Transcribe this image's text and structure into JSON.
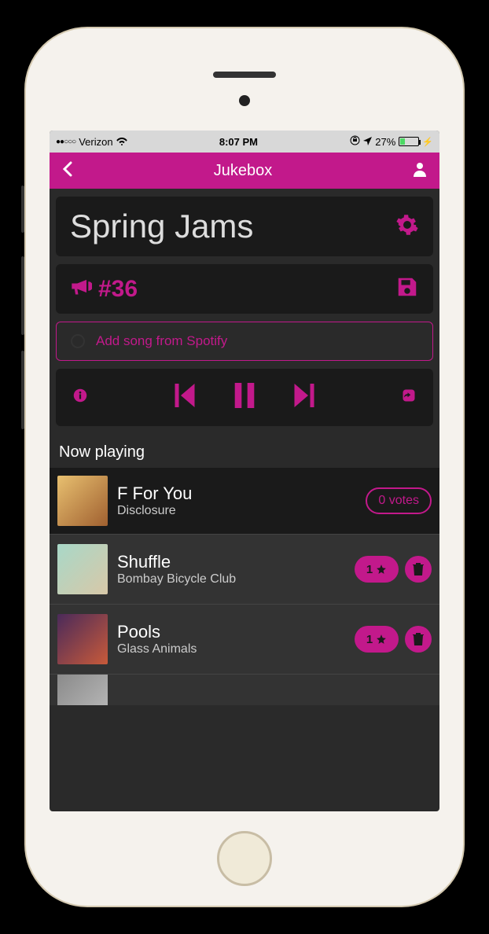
{
  "statusbar": {
    "carrier": "Verizon",
    "time": "8:07 PM",
    "battery_pct": "27%"
  },
  "header": {
    "title": "Jukebox"
  },
  "playlist": {
    "title": "Spring Jams"
  },
  "room": {
    "label": "#36"
  },
  "add_song": {
    "label": "Add song from Spotify"
  },
  "now_playing": {
    "section_label": "Now playing",
    "title": "F For You",
    "artist": "Disclosure",
    "votes_label": "0 votes"
  },
  "queue": [
    {
      "title": "Shuffle",
      "artist": "Bombay Bicycle Club",
      "votes": "1"
    },
    {
      "title": "Pools",
      "artist": "Glass Animals",
      "votes": "1"
    }
  ]
}
